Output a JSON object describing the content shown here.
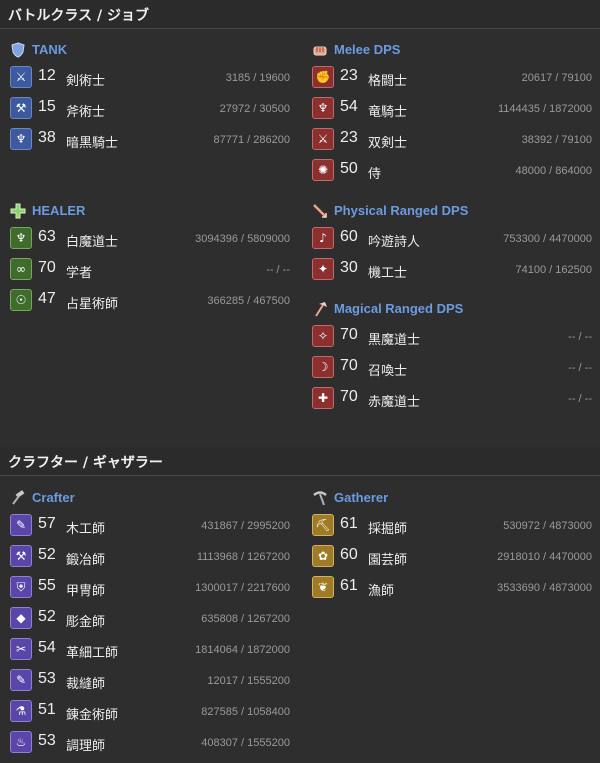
{
  "sections": [
    {
      "title": "バトルクラス / ジョブ"
    },
    {
      "title": "クラフター / ギャザラー"
    }
  ],
  "categories": {
    "tank": {
      "label": "TANK",
      "icon": "shield-icon",
      "color": "#6b9be0"
    },
    "healer": {
      "label": "HEALER",
      "icon": "cross-icon",
      "color": "#6b9be0"
    },
    "melee": {
      "label": "Melee DPS",
      "icon": "fist-icon",
      "color": "#6b9be0"
    },
    "phys": {
      "label": "Physical Ranged DPS",
      "icon": "bow-icon",
      "color": "#6b9be0"
    },
    "magic": {
      "label": "Magical Ranged DPS",
      "icon": "staff-icon",
      "color": "#6b9be0"
    },
    "crafter": {
      "label": "Crafter",
      "icon": "hammer-icon",
      "color": "#6b9be0"
    },
    "gatherer": {
      "label": "Gatherer",
      "icon": "pickaxe-icon",
      "color": "#6b9be0"
    }
  },
  "jobs": {
    "tank": [
      {
        "level": "12",
        "name": "剣術士",
        "exp": "3185 / 19600"
      },
      {
        "level": "15",
        "name": "斧術士",
        "exp": "27972 / 30500"
      },
      {
        "level": "38",
        "name": "暗黒騎士",
        "exp": "87771 / 286200"
      }
    ],
    "healer": [
      {
        "level": "63",
        "name": "白魔道士",
        "exp": "3094396 / 5809000"
      },
      {
        "level": "70",
        "name": "学者",
        "exp": "-- / --"
      },
      {
        "level": "47",
        "name": "占星術師",
        "exp": "366285 / 467500"
      }
    ],
    "melee": [
      {
        "level": "23",
        "name": "格闘士",
        "exp": "20617 / 79100"
      },
      {
        "level": "54",
        "name": "竜騎士",
        "exp": "1144435 / 1872000"
      },
      {
        "level": "23",
        "name": "双剣士",
        "exp": "38392 / 79100"
      },
      {
        "level": "50",
        "name": "侍",
        "exp": "48000 / 864000"
      }
    ],
    "phys": [
      {
        "level": "60",
        "name": "吟遊詩人",
        "exp": "753300 / 4470000"
      },
      {
        "level": "30",
        "name": "機工士",
        "exp": "74100 / 162500"
      }
    ],
    "magic": [
      {
        "level": "70",
        "name": "黒魔道士",
        "exp": "-- / --"
      },
      {
        "level": "70",
        "name": "召喚士",
        "exp": "-- / --"
      },
      {
        "level": "70",
        "name": "赤魔道士",
        "exp": "-- / --"
      }
    ],
    "crafter": [
      {
        "level": "57",
        "name": "木工師",
        "exp": "431867 / 2995200"
      },
      {
        "level": "52",
        "name": "鍛冶師",
        "exp": "1113968 / 1267200"
      },
      {
        "level": "55",
        "name": "甲冑師",
        "exp": "1300017 / 2217600"
      },
      {
        "level": "52",
        "name": "彫金師",
        "exp": "635808 / 1267200"
      },
      {
        "level": "54",
        "name": "革細工師",
        "exp": "1814064 / 1872000"
      },
      {
        "level": "53",
        "name": "裁縫師",
        "exp": "12017 / 1555200"
      },
      {
        "level": "51",
        "name": "錬金術師",
        "exp": "827585 / 1058400"
      },
      {
        "level": "53",
        "name": "調理師",
        "exp": "408307 / 1555200"
      }
    ],
    "gatherer": [
      {
        "level": "61",
        "name": "採掘師",
        "exp": "530972 / 4873000"
      },
      {
        "level": "60",
        "name": "園芸師",
        "exp": "2918010 / 4470000"
      },
      {
        "level": "61",
        "name": "漁師",
        "exp": "3533690 / 4873000"
      }
    ]
  },
  "job_icons": {
    "tank": [
      "sword-icon",
      "axe-icon",
      "dark-knight-icon"
    ],
    "healer": [
      "white-mage-icon",
      "scholar-icon",
      "astrologian-icon"
    ],
    "melee": [
      "pugilist-icon",
      "dragoon-icon",
      "rogue-icon",
      "samurai-icon"
    ],
    "phys": [
      "bard-icon",
      "machinist-icon"
    ],
    "magic": [
      "black-mage-icon",
      "summoner-icon",
      "red-mage-icon"
    ],
    "crafter": [
      "carpenter-icon",
      "blacksmith-icon",
      "armorer-icon",
      "goldsmith-icon",
      "leatherworker-icon",
      "weaver-icon",
      "alchemist-icon",
      "culinarian-icon"
    ],
    "gatherer": [
      "miner-icon",
      "botanist-icon",
      "fisher-icon"
    ]
  }
}
